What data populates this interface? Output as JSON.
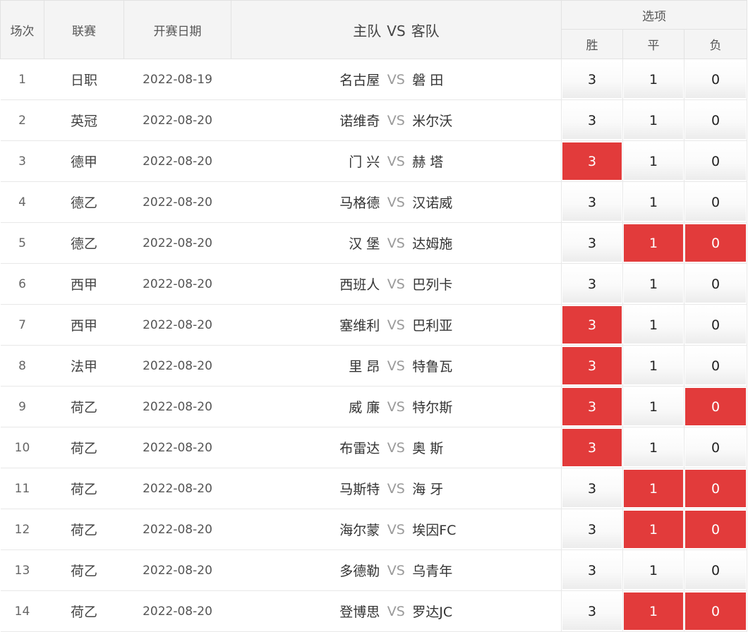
{
  "colors": {
    "selected_bg": "#e23b3b",
    "selected_text": "#ffffff",
    "header_bg": "#f4f4f4",
    "vs_text": "#9a9a9a"
  },
  "header": {
    "col_num": "场次",
    "col_league": "联赛",
    "col_date": "开赛日期",
    "col_home": "主队",
    "col_vs": "VS",
    "col_away": "客队",
    "col_options": "选项",
    "opt_win": "胜",
    "opt_draw": "平",
    "opt_lose": "负"
  },
  "vs_label": "VS",
  "matches": [
    {
      "num": "1",
      "league": "日职",
      "date": "2022-08-19",
      "home": "名古屋",
      "away": "磐 田",
      "win": "3",
      "draw": "1",
      "lose": "0",
      "win_sel": false,
      "draw_sel": false,
      "lose_sel": false
    },
    {
      "num": "2",
      "league": "英冠",
      "date": "2022-08-20",
      "home": "诺维奇",
      "away": "米尔沃",
      "win": "3",
      "draw": "1",
      "lose": "0",
      "win_sel": false,
      "draw_sel": false,
      "lose_sel": false
    },
    {
      "num": "3",
      "league": "德甲",
      "date": "2022-08-20",
      "home": "门 兴",
      "away": "赫 塔",
      "win": "3",
      "draw": "1",
      "lose": "0",
      "win_sel": true,
      "draw_sel": false,
      "lose_sel": false
    },
    {
      "num": "4",
      "league": "德乙",
      "date": "2022-08-20",
      "home": "马格德",
      "away": "汉诺威",
      "win": "3",
      "draw": "1",
      "lose": "0",
      "win_sel": false,
      "draw_sel": false,
      "lose_sel": false
    },
    {
      "num": "5",
      "league": "德乙",
      "date": "2022-08-20",
      "home": "汉 堡",
      "away": "达姆施",
      "win": "3",
      "draw": "1",
      "lose": "0",
      "win_sel": false,
      "draw_sel": true,
      "lose_sel": true
    },
    {
      "num": "6",
      "league": "西甲",
      "date": "2022-08-20",
      "home": "西班人",
      "away": "巴列卡",
      "win": "3",
      "draw": "1",
      "lose": "0",
      "win_sel": false,
      "draw_sel": false,
      "lose_sel": false
    },
    {
      "num": "7",
      "league": "西甲",
      "date": "2022-08-20",
      "home": "塞维利",
      "away": "巴利亚",
      "win": "3",
      "draw": "1",
      "lose": "0",
      "win_sel": true,
      "draw_sel": false,
      "lose_sel": false
    },
    {
      "num": "8",
      "league": "法甲",
      "date": "2022-08-20",
      "home": "里 昂",
      "away": "特鲁瓦",
      "win": "3",
      "draw": "1",
      "lose": "0",
      "win_sel": true,
      "draw_sel": false,
      "lose_sel": false
    },
    {
      "num": "9",
      "league": "荷乙",
      "date": "2022-08-20",
      "home": "威 廉",
      "away": "特尔斯",
      "win": "3",
      "draw": "1",
      "lose": "0",
      "win_sel": true,
      "draw_sel": false,
      "lose_sel": true
    },
    {
      "num": "10",
      "league": "荷乙",
      "date": "2022-08-20",
      "home": "布雷达",
      "away": "奥 斯",
      "win": "3",
      "draw": "1",
      "lose": "0",
      "win_sel": true,
      "draw_sel": false,
      "lose_sel": false
    },
    {
      "num": "11",
      "league": "荷乙",
      "date": "2022-08-20",
      "home": "马斯特",
      "away": "海 牙",
      "win": "3",
      "draw": "1",
      "lose": "0",
      "win_sel": false,
      "draw_sel": true,
      "lose_sel": true
    },
    {
      "num": "12",
      "league": "荷乙",
      "date": "2022-08-20",
      "home": "海尔蒙",
      "away": "埃因FC",
      "win": "3",
      "draw": "1",
      "lose": "0",
      "win_sel": false,
      "draw_sel": true,
      "lose_sel": true
    },
    {
      "num": "13",
      "league": "荷乙",
      "date": "2022-08-20",
      "home": "多德勒",
      "away": "乌青年",
      "win": "3",
      "draw": "1",
      "lose": "0",
      "win_sel": false,
      "draw_sel": false,
      "lose_sel": false
    },
    {
      "num": "14",
      "league": "荷乙",
      "date": "2022-08-20",
      "home": "登博思",
      "away": "罗达JC",
      "win": "3",
      "draw": "1",
      "lose": "0",
      "win_sel": false,
      "draw_sel": true,
      "lose_sel": true
    }
  ]
}
